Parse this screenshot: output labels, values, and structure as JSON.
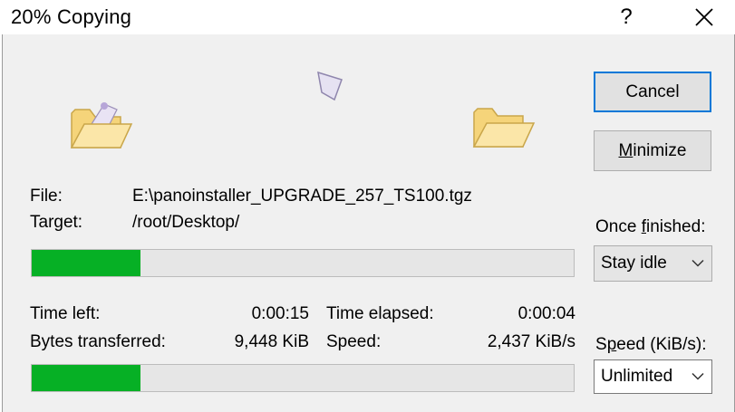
{
  "window": {
    "title": "20% Copying",
    "help_label": "?"
  },
  "buttons": {
    "cancel": "Cancel",
    "minimize_underlined": "M",
    "minimize_rest": "inimize"
  },
  "file": {
    "file_label": "File:",
    "file_value": "E:\\panoinstaller_UPGRADE_257_TS100.tgz",
    "target_label": "Target:",
    "target_value": "/root/Desktop/",
    "progress_fraction": 0.2
  },
  "once_finished": {
    "label_pre": "Once ",
    "label_underlined": "f",
    "label_post": "inished:",
    "selected": "Stay idle"
  },
  "stats": {
    "time_left_label": "Time left:",
    "time_left_value": "0:00:15",
    "time_elapsed_label": "Time elapsed:",
    "time_elapsed_value": "0:00:04",
    "bytes_label": "Bytes transferred:",
    "bytes_value": "9,448 KiB",
    "speed_label": "Speed:",
    "speed_value": "2,437 KiB/s",
    "overall_progress_fraction": 0.2
  },
  "speed_limit": {
    "label_pre": "S",
    "label_underlined": "p",
    "label_post": "eed (KiB/s):",
    "selected": "Unlimited"
  },
  "colors": {
    "progress_fill": "#06b025",
    "accent_border": "#0078d7"
  }
}
